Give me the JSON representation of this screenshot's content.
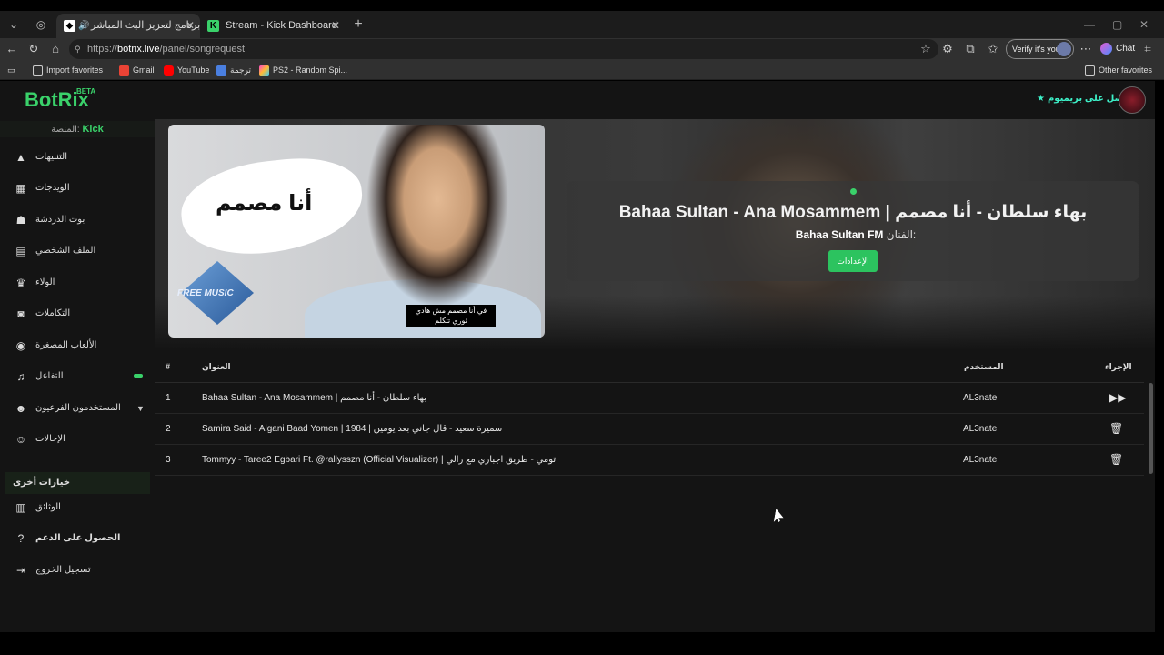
{
  "browser": {
    "tabs": [
      {
        "label": "أفضل برنامج لتعزيز البث المباشر"
      },
      {
        "label": "Stream - Kick Dashboard"
      }
    ],
    "new_tab": "+",
    "url_prefix": "https://",
    "url_host": "botrix.live",
    "url_path": "/panel/songrequest",
    "verify_label": "Verify it's you",
    "chat_label": "Chat",
    "bookmarks": [
      {
        "label": "Import favorites"
      },
      {
        "label": "Gmail"
      },
      {
        "label": "YouTube"
      },
      {
        "label": "ترجمة"
      },
      {
        "label": "PS2 - Random Spi..."
      }
    ],
    "other_favorites": "Other favorites"
  },
  "app": {
    "logo": "BotRix",
    "logo_badge": "BETA",
    "premium_label": "احصل على بريميوم",
    "platform_label": "المنصة:",
    "platform_value": "Kick",
    "sidebar": {
      "items": [
        {
          "label": "التنبيهات",
          "icon": "warning-icon"
        },
        {
          "label": "الويدجات",
          "icon": "grid-icon"
        },
        {
          "label": "بوت الدردشة",
          "icon": "robot-icon"
        },
        {
          "label": "الملف الشخصي",
          "icon": "id-card-icon"
        },
        {
          "label": "الولاء",
          "icon": "trophy-icon"
        },
        {
          "label": "التكاملات",
          "icon": "plug-icon"
        },
        {
          "label": "الألعاب المصغرة",
          "icon": "gamepad-icon"
        },
        {
          "label": "التفاعل",
          "icon": "music-icon"
        },
        {
          "label": "المستخدمون الفرعيون",
          "icon": "users-icon"
        },
        {
          "label": "الإحالات",
          "icon": "user-group-icon"
        }
      ],
      "section_label": "خيارات أخرى",
      "other": [
        {
          "label": "الوثائق",
          "icon": "scroll-icon"
        },
        {
          "label": "الحصول على الدعم",
          "icon": "question-icon"
        },
        {
          "label": "تسجيل الخروج",
          "icon": "logout-icon"
        }
      ]
    },
    "now_playing": {
      "title": "Bahaa Sultan - Ana Mosammem | بهاء سلطان - أنا مصمم",
      "artist_label": "الفنان:",
      "artist_name": "Bahaa Sultan FM",
      "settings_label": "الإعدادات",
      "thumbnail_text": "أنا مصمم",
      "thumbnail_logo": "FREE MUSIC",
      "thumbnail_caption": "في أنا مصمم مش هادي ثوري تتكلم"
    },
    "queue": {
      "headers": {
        "num": "#",
        "title": "العنوان",
        "user": "المستخدم",
        "action": "الإجراء"
      },
      "rows": [
        {
          "num": "1",
          "title": "Bahaa Sultan - Ana Mosammem | بهاء سلطان - أنا مصمم",
          "user": "AL3nate",
          "action": "play-next-icon"
        },
        {
          "num": "2",
          "title": "Samira Said - Algani Baad Yomen | 1984 | سميرة سعيد - قال جاني بعد يومين",
          "user": "AL3nate",
          "action": "trash-icon"
        },
        {
          "num": "3",
          "title": "Tommyy - Taree2 Egbari Ft. @rallysszn (Official Visualizer) | تومي - طريق اجباري مع رالي",
          "user": "AL3nate",
          "action": "trash-icon"
        }
      ]
    }
  },
  "colors": {
    "accent": "#3ad16a",
    "premium": "#3df0c8"
  }
}
